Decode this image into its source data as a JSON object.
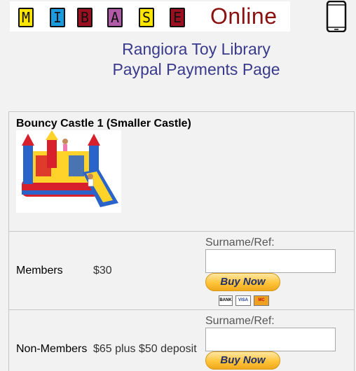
{
  "header": {
    "tiles": [
      {
        "letter": "M",
        "color": "#ffe600"
      },
      {
        "letter": "I",
        "color": "#1a9be0"
      },
      {
        "letter": "B",
        "color": "#9a1020"
      },
      {
        "letter": "A",
        "color": "#b05aa8"
      },
      {
        "letter": "S",
        "color": "#ffe600"
      },
      {
        "letter": "E",
        "color": "#9a1020"
      }
    ],
    "online_text": "Online",
    "phone_icon": "mobile-phone-icon"
  },
  "title": {
    "line1": "Rangiora Toy Library",
    "line2": "Paypal Payments Page"
  },
  "item": {
    "name": "Bouncy Castle 1 (Smaller Castle)"
  },
  "rows": [
    {
      "label": "Members",
      "price": "$30",
      "field_label": "Surname/Ref:",
      "field_value": "",
      "button": "Buy Now"
    },
    {
      "label": "Non-Members",
      "price": "$65 plus $50 deposit",
      "field_label": "Surname/Ref:",
      "field_value": "",
      "button": "Buy Now"
    }
  ],
  "payment_cards": [
    "BANK",
    "VISA",
    "MC"
  ],
  "colors": {
    "title": "#3a3a8c",
    "online": "#8b1010",
    "paypal_button": "#ffc439"
  }
}
